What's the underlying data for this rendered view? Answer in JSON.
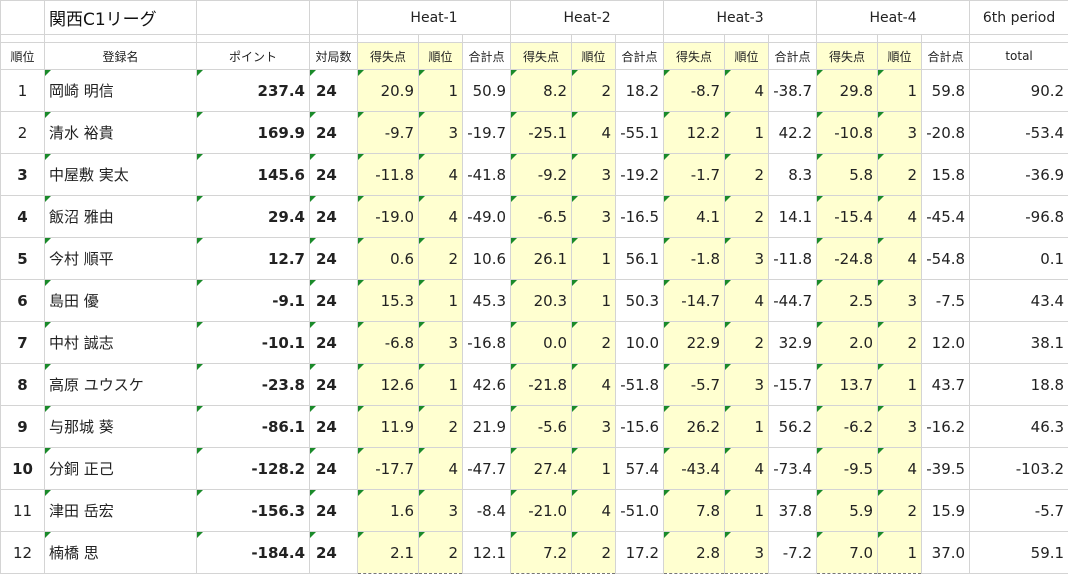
{
  "sheet": {
    "title": "関西C1リーグ",
    "heats": [
      "Heat-1",
      "Heat-2",
      "Heat-3",
      "Heat-4",
      "6th period"
    ],
    "headers": {
      "rank": "順位",
      "name": "登録名",
      "points": "ポイント",
      "games": "対局数",
      "score": "得失点",
      "place": "順位",
      "total": "合計点",
      "period_total": "total"
    },
    "rows": [
      {
        "rank": "1",
        "rank_color": "blue",
        "name": "岡崎 明信",
        "points": "237.4",
        "games": "24",
        "h1": [
          "20.9",
          "1",
          "50.9"
        ],
        "h2": [
          "8.2",
          "2",
          "18.2"
        ],
        "h3": [
          "-8.7",
          "4",
          "-38.7"
        ],
        "h4": [
          "29.8",
          "1",
          "59.8"
        ],
        "total": "90.2"
      },
      {
        "rank": "2",
        "rank_color": "blue",
        "name": "清水 裕貴",
        "points": "169.9",
        "games": "24",
        "h1": [
          "-9.7",
          "3",
          "-19.7"
        ],
        "h2": [
          "-25.1",
          "4",
          "-55.1"
        ],
        "h3": [
          "12.2",
          "1",
          "42.2"
        ],
        "h4": [
          "-10.8",
          "3",
          "-20.8"
        ],
        "total": "-53.4"
      },
      {
        "rank": "3",
        "rank_color": "black",
        "name": "中屋敷 実太",
        "points": "145.6",
        "games": "24",
        "h1": [
          "-11.8",
          "4",
          "-41.8"
        ],
        "h2": [
          "-9.2",
          "3",
          "-19.2"
        ],
        "h3": [
          "-1.7",
          "2",
          "8.3"
        ],
        "h4": [
          "5.8",
          "2",
          "15.8"
        ],
        "total": "-36.9"
      },
      {
        "rank": "4",
        "rank_color": "black",
        "name": "飯沼 雅由",
        "points": "29.4",
        "games": "24",
        "h1": [
          "-19.0",
          "4",
          "-49.0"
        ],
        "h2": [
          "-6.5",
          "3",
          "-16.5"
        ],
        "h3": [
          "4.1",
          "2",
          "14.1"
        ],
        "h4": [
          "-15.4",
          "4",
          "-45.4"
        ],
        "total": "-96.8"
      },
      {
        "rank": "5",
        "rank_color": "black",
        "name": "今村 順平",
        "points": "12.7",
        "games": "24",
        "h1": [
          "0.6",
          "2",
          "10.6"
        ],
        "h2": [
          "26.1",
          "1",
          "56.1"
        ],
        "h3": [
          "-1.8",
          "3",
          "-11.8"
        ],
        "h4": [
          "-24.8",
          "4",
          "-54.8"
        ],
        "total": "0.1"
      },
      {
        "rank": "6",
        "rank_color": "black",
        "name": "島田 優",
        "points": "-9.1",
        "games": "24",
        "h1": [
          "15.3",
          "1",
          "45.3"
        ],
        "h2": [
          "20.3",
          "1",
          "50.3"
        ],
        "h3": [
          "-14.7",
          "4",
          "-44.7"
        ],
        "h4": [
          "2.5",
          "3",
          "-7.5"
        ],
        "total": "43.4"
      },
      {
        "rank": "7",
        "rank_color": "black",
        "name": "中村 誠志",
        "points": "-10.1",
        "games": "24",
        "h1": [
          "-6.8",
          "3",
          "-16.8"
        ],
        "h2": [
          "0.0",
          "2",
          "10.0"
        ],
        "h3": [
          "22.9",
          "2",
          "32.9"
        ],
        "h4": [
          "2.0",
          "2",
          "12.0"
        ],
        "total": "38.1"
      },
      {
        "rank": "8",
        "rank_color": "black",
        "name": "高原 ユウスケ",
        "points": "-23.8",
        "games": "24",
        "h1": [
          "12.6",
          "1",
          "42.6"
        ],
        "h2": [
          "-21.8",
          "4",
          "-51.8"
        ],
        "h3": [
          "-5.7",
          "3",
          "-15.7"
        ],
        "h4": [
          "13.7",
          "1",
          "43.7"
        ],
        "total": "18.8"
      },
      {
        "rank": "9",
        "rank_color": "black",
        "name": "与那城 葵",
        "points": "-86.1",
        "games": "24",
        "h1": [
          "11.9",
          "2",
          "21.9"
        ],
        "h2": [
          "-5.6",
          "3",
          "-15.6"
        ],
        "h3": [
          "26.2",
          "1",
          "56.2"
        ],
        "h4": [
          "-6.2",
          "3",
          "-16.2"
        ],
        "total": "46.3"
      },
      {
        "rank": "10",
        "rank_color": "black",
        "name": "分銅 正己",
        "points": "-128.2",
        "games": "24",
        "h1": [
          "-17.7",
          "4",
          "-47.7"
        ],
        "h2": [
          "27.4",
          "1",
          "57.4"
        ],
        "h3": [
          "-43.4",
          "4",
          "-73.4"
        ],
        "h4": [
          "-9.5",
          "4",
          "-39.5"
        ],
        "total": "-103.2"
      },
      {
        "rank": "11",
        "rank_color": "red",
        "name": "津田 岳宏",
        "points": "-156.3",
        "games": "24",
        "h1": [
          "1.6",
          "3",
          "-8.4"
        ],
        "h2": [
          "-21.0",
          "4",
          "-51.0"
        ],
        "h3": [
          "7.8",
          "1",
          "37.8"
        ],
        "h4": [
          "5.9",
          "2",
          "15.9"
        ],
        "total": "-5.7"
      },
      {
        "rank": "12",
        "rank_color": "red",
        "name": "楠橋 思",
        "points": "-184.4",
        "games": "24",
        "h1": [
          "2.1",
          "2",
          "12.1"
        ],
        "h2": [
          "7.2",
          "2",
          "17.2"
        ],
        "h3": [
          "2.8",
          "3",
          "-7.2"
        ],
        "h4": [
          "7.0",
          "1",
          "37.0"
        ],
        "total": "59.1"
      }
    ]
  }
}
